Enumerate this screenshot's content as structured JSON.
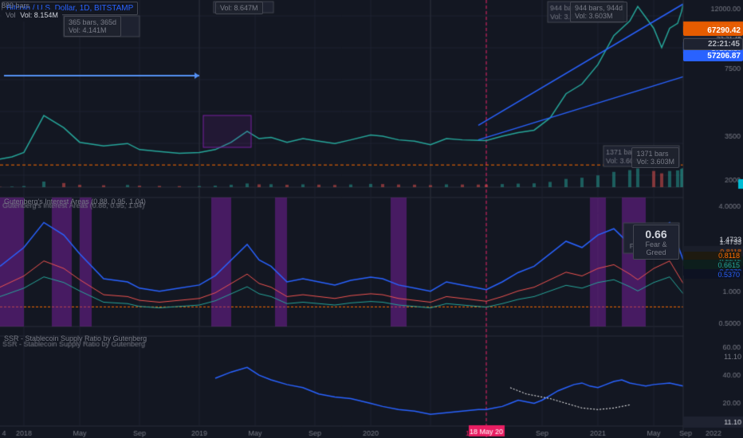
{
  "header": {
    "title": "Bitcoin / U.S. Dollar, 1D, BITSTAMP",
    "bars_label": "889 bars",
    "timeframe": "1D"
  },
  "annotations": {
    "vol_365": "365 bars, 365d",
    "vol_365_value": "Vol: 4.141M",
    "vol_8647": "Vol: 8.647M",
    "vol_944": "944 bars, 944d",
    "vol_944_value": "Vol: 3.603M",
    "vol_8154": "Vol: 8.154M",
    "bars_1371": "1371 bars",
    "vol_3603": "Vol: 3.603M",
    "interest_areas": "Gutenberg&#039;s Interest Areas (0.88, 0.95, 1.04)",
    "ssr_label": "SSR - Stablecoin Supply Ratio by Gutenberg"
  },
  "price_levels": {
    "main_high": "12000.00",
    "p1": "67290.42",
    "p2": "22:21:45",
    "p3": "57206.87",
    "p4": "7500.00",
    "p5": "3500.00",
    "p6": "2000.00",
    "p7": "4.0000",
    "p8": "1.4733",
    "p9": "0.8118",
    "p10": "0.6615",
    "p11": "0.5370",
    "p12": "60.00",
    "p13": "40.00",
    "p14": "20.00",
    "p15": "11.10"
  },
  "fear_greed": {
    "value": "0.66",
    "label": "Fear & Greed"
  },
  "x_axis": {
    "labels": [
      "4",
      "2018",
      "May",
      "Sep",
      "2019",
      "May",
      "Sep",
      "2020",
      "18 May 20",
      "Sep",
      "2021",
      "May",
      "Sep",
      "2022"
    ]
  },
  "colors": {
    "background": "#131722",
    "grid": "#1e2230",
    "blue_line": "#2962ff",
    "orange_line": "#ff6d00",
    "red_line": "#ff4444",
    "green_line": "#26a69a",
    "purple_fill": "#7b1fa2",
    "price_tag_orange": "#e65c00",
    "accent_teal": "#00bcd4"
  }
}
